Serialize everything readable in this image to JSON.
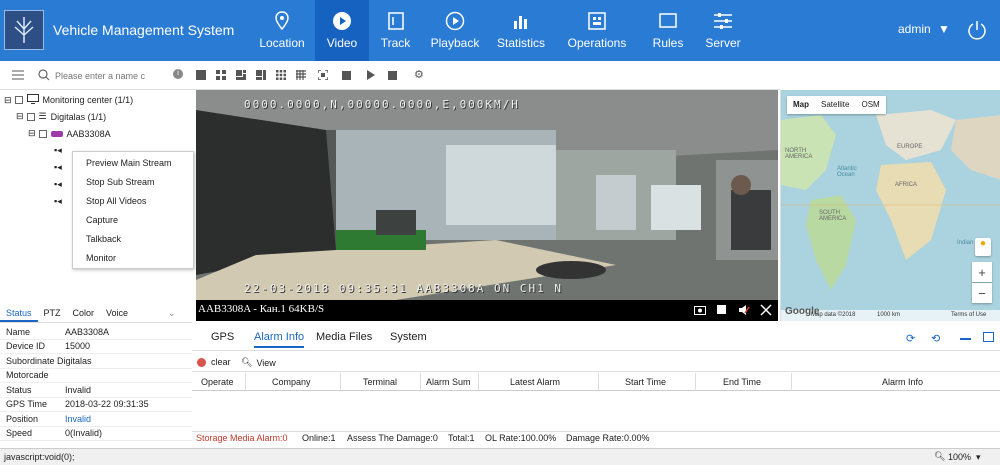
{
  "header": {
    "title": "Vehicle Management System",
    "nav": [
      {
        "label": "Location",
        "icon": "location-pin-icon"
      },
      {
        "label": "Video",
        "icon": "play-circle-icon",
        "active": true
      },
      {
        "label": "Track",
        "icon": "track-icon"
      },
      {
        "label": "Playback",
        "icon": "playback-icon"
      },
      {
        "label": "Statistics",
        "icon": "bar-chart-icon"
      },
      {
        "label": "Operations",
        "icon": "operations-icon"
      },
      {
        "label": "Rules",
        "icon": "rules-icon"
      },
      {
        "label": "Server",
        "icon": "server-icon"
      }
    ],
    "user": "admin"
  },
  "left": {
    "search_placeholder": "Please enter a name c",
    "tree": {
      "root": "Monitoring center  (1/1)",
      "group": "Digitalas  (1/1)",
      "vehicle": "AAB3308A"
    },
    "context_menu": [
      "Preview Main Stream",
      "Stop Sub Stream",
      "Stop All Videos",
      "Capture",
      "Talkback",
      "Monitor"
    ],
    "tabs": [
      "Status",
      "PTZ",
      "Color",
      "Voice"
    ],
    "status": [
      {
        "k": "Name",
        "v": "AAB3308A"
      },
      {
        "k": "Device ID",
        "v": "15000"
      },
      {
        "k": "Subordinate Digitalas",
        "v": ""
      },
      {
        "k": "Motorcade",
        "v": ""
      },
      {
        "k": "Status",
        "v": "Invalid"
      },
      {
        "k": "GPS Time",
        "v": "2018-03-22 09:31:35"
      },
      {
        "k": "Position",
        "v": "Invalid"
      },
      {
        "k": "Speed",
        "v": "0(Invalid)"
      }
    ]
  },
  "video": {
    "osd_top": "0000.0000,N,00000.0000,E,000KM/H",
    "osd_bottom": "22-03-2018 09:35:31 AAB3308A ON  CH1 N",
    "caption": "AAB3308A - Кан.1 64KB/S"
  },
  "map": {
    "tabs": [
      "Map",
      "Satellite",
      "OSM"
    ],
    "labels": [
      "NORTH AMERICA",
      "EUROPE",
      "AFRICA",
      "SOUTH AMERICA",
      "Atlantic Ocean",
      "Indian"
    ],
    "footer_data": "Map data ©2018",
    "footer_scale": "1000 km",
    "footer_terms": "Terms of Use",
    "google": "Google"
  },
  "bottom": {
    "tabs": [
      "GPS",
      "Alarm Info",
      "Media Files",
      "System"
    ],
    "clear_label": "clear",
    "view_label": "View",
    "columns": [
      "Operate",
      "Company",
      "Terminal",
      "Alarm Sum",
      "Latest Alarm",
      "Start Time",
      "End Time",
      "Alarm Info"
    ],
    "stats": {
      "storage": "Storage Media Alarm:0",
      "online": "Online:1",
      "assess": "Assess The Damage:0",
      "total": "Total:1",
      "ol_rate": "OL Rate:100.00%",
      "damage": "Damage Rate:0.00%"
    }
  },
  "browser_status": {
    "url": "javascript:void(0);",
    "zoom": "100%"
  },
  "colors": {
    "header": "#2a7bd4",
    "header_active": "#1662c0",
    "accent": "#1a66c2",
    "alarm_red": "#c0392b"
  }
}
